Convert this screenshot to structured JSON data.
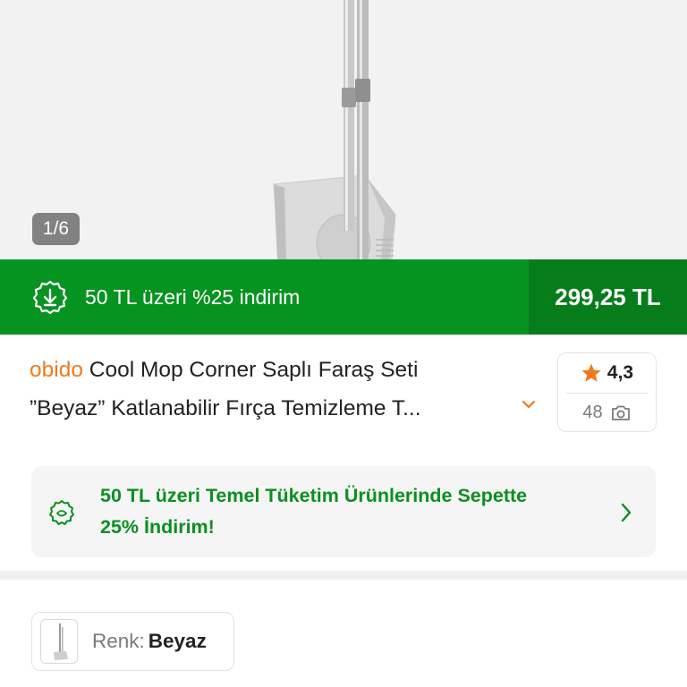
{
  "gallery": {
    "counter": "1/6"
  },
  "promo_bar": {
    "text": "50 TL üzeri %25 indirim",
    "price": "299,25 TL",
    "icon": "discount-download-badge-icon",
    "bg_color": "#07931f",
    "price_bg_color": "#067d1a"
  },
  "product": {
    "brand": "obido",
    "title_line1": "Cool Mop Corner Saplı Faraş Seti",
    "title_line2": "”Beyaz” Katlanabilir Fırça Temizleme T...",
    "brand_color": "#f27a1a"
  },
  "rating": {
    "score": "4,3",
    "photo_count": "48",
    "star_color": "#f27a1a"
  },
  "campaign": {
    "line1": "50 TL üzeri Temel Tüketim Ürünlerinde Sepette",
    "line2": "25% İndirim!",
    "text_color": "#0a8f22",
    "icon": "campaign-badge-icon"
  },
  "variant": {
    "label": "Renk:",
    "value": "Beyaz"
  }
}
